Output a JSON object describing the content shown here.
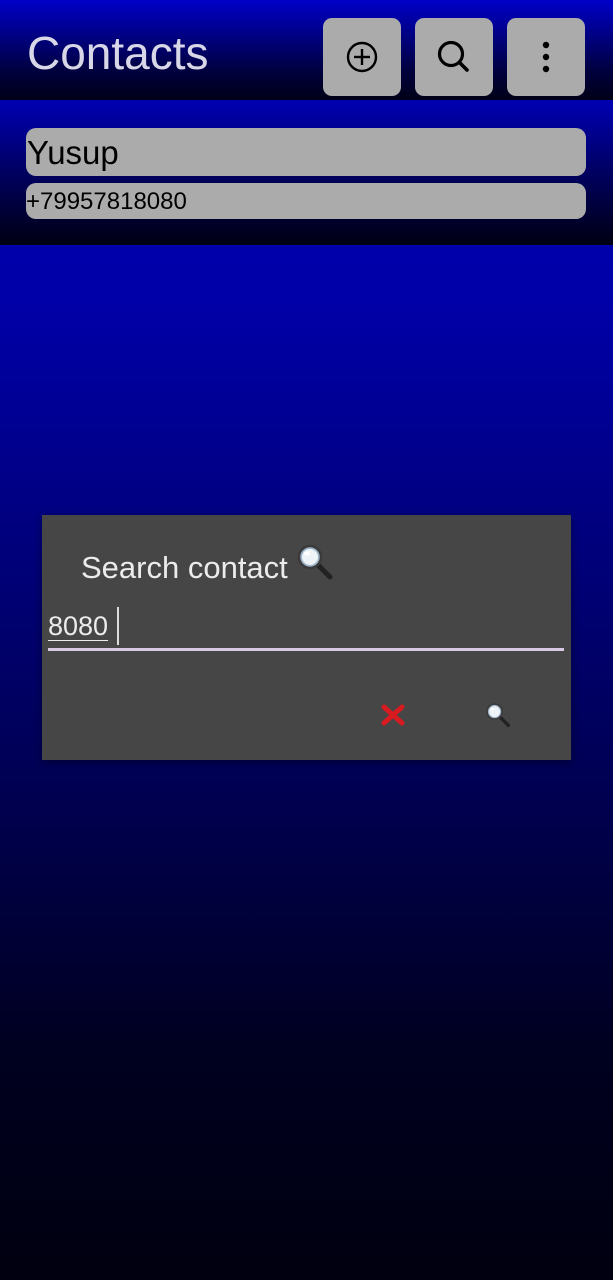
{
  "app": {
    "title": "Contacts"
  },
  "toolbar": {
    "add_icon": "circled-plus-icon",
    "search_icon": "search-icon",
    "more_icon": "more-vertical-icon"
  },
  "contacts": [
    {
      "name": "Yusup",
      "phone": "+79957818080"
    }
  ],
  "dialog": {
    "title": "Search contact",
    "title_icon": "magnifier-icon",
    "search_value": "8080",
    "cancel_icon": "cross-mark-icon",
    "confirm_icon": "magnifier-icon"
  },
  "colors": {
    "button_bg": "#ababab",
    "dialog_bg": "#464646",
    "field_underline": "#d7c9e2",
    "cancel_red": "#d81b20"
  }
}
